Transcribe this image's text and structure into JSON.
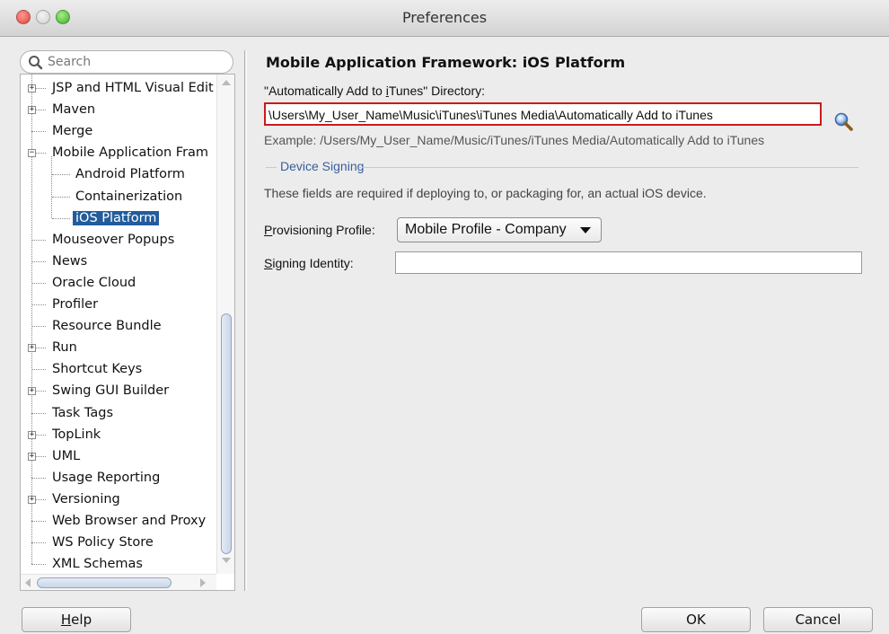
{
  "window": {
    "title": "Preferences",
    "controls": {
      "close_color": "#e0443a",
      "minimize_color": "#cfcfcf",
      "maximize_color": "#3fae2c"
    }
  },
  "search": {
    "placeholder": "Search",
    "icon": "search-icon"
  },
  "tree": {
    "items": [
      {
        "label": "JSP and HTML Visual Edit",
        "expandable": true
      },
      {
        "label": "Maven",
        "expandable": true
      },
      {
        "label": "Merge",
        "expandable": false
      },
      {
        "label": "Mobile Application Fram",
        "expandable": true,
        "expanded": true
      },
      {
        "label": "Android Platform",
        "child": true
      },
      {
        "label": "Containerization",
        "child": true
      },
      {
        "label": "iOS Platform",
        "child": true,
        "selected": true
      },
      {
        "label": "Mouseover Popups",
        "expandable": false
      },
      {
        "label": "News",
        "expandable": false
      },
      {
        "label": "Oracle Cloud",
        "expandable": false
      },
      {
        "label": "Profiler",
        "expandable": false
      },
      {
        "label": "Resource Bundle",
        "expandable": false
      },
      {
        "label": "Run",
        "expandable": true
      },
      {
        "label": "Shortcut Keys",
        "expandable": false
      },
      {
        "label": "Swing GUI Builder",
        "expandable": true
      },
      {
        "label": "Task Tags",
        "expandable": false
      },
      {
        "label": "TopLink",
        "expandable": true
      },
      {
        "label": "UML",
        "expandable": true
      },
      {
        "label": "Usage Reporting",
        "expandable": false
      },
      {
        "label": "Versioning",
        "expandable": true
      },
      {
        "label": "Web Browser and Proxy",
        "expandable": false
      },
      {
        "label": "WS Policy Store",
        "expandable": false
      },
      {
        "label": "XML Schemas",
        "expandable": false
      }
    ]
  },
  "panel": {
    "title": "Mobile Application Framework: iOS Platform",
    "itunes_label_pre": "\"Automatically Add to ",
    "itunes_label_mnemonic": "i",
    "itunes_label_post": "Tunes\" Directory:",
    "itunes_dir_value": "\\Users\\My_User_Name\\Music\\iTunes\\iTunes Media\\Automatically Add to iTunes",
    "browse_icon": "magnifier-icon",
    "example": "Example: /Users/My_User_Name/Music/iTunes/iTunes Media/Automatically Add to iTunes",
    "device_signing": {
      "section_label": "Device Signing",
      "note": "These fields are required if deploying to, or packaging for, an actual iOS device.",
      "provisioning_label_mnemonic": "P",
      "provisioning_label_rest": "rovisioning Profile:",
      "provisioning_value": "Mobile Profile - Company",
      "signing_label_mnemonic": "S",
      "signing_label_rest": "igning Identity:",
      "signing_value": ""
    }
  },
  "buttons": {
    "help_mnemonic": "H",
    "help_rest": "elp",
    "ok": "OK",
    "cancel": "Cancel"
  },
  "colors": {
    "selection": "#225c9d",
    "highlight_border": "#cc1a1a",
    "section_label": "#3a5f9a"
  }
}
